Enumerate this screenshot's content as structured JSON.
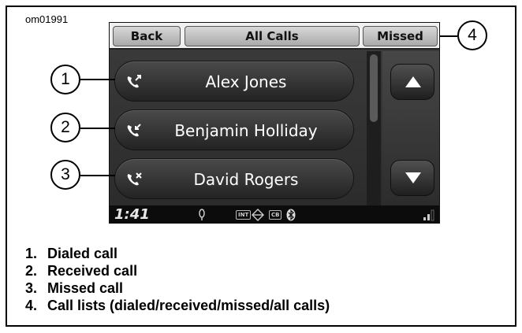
{
  "figure_id": "om01991",
  "screen": {
    "tabs": {
      "back": "Back",
      "all": "All Calls",
      "missed": "Missed"
    },
    "calls": [
      {
        "name": "Alex Jones",
        "icon": "dialed-call-icon"
      },
      {
        "name": "Benjamin Holliday",
        "icon": "received-call-icon"
      },
      {
        "name": "David Rogers",
        "icon": "missed-call-icon"
      }
    ],
    "status": {
      "time": "1:41",
      "tag_int": "INT",
      "tag_cb": "CB"
    }
  },
  "callouts": [
    "1",
    "2",
    "3",
    "4"
  ],
  "legend": [
    {
      "num": "1.",
      "text": "Dialed call"
    },
    {
      "num": "2.",
      "text": "Received call"
    },
    {
      "num": "3.",
      "text": "Missed call"
    },
    {
      "num": "4.",
      "text": "Call lists (dialed/received/missed/all calls)"
    }
  ],
  "colors": {
    "screen_bg": "#2e2e2e",
    "row_text": "#ffffff",
    "tab_bg": "#c8c8c8"
  }
}
